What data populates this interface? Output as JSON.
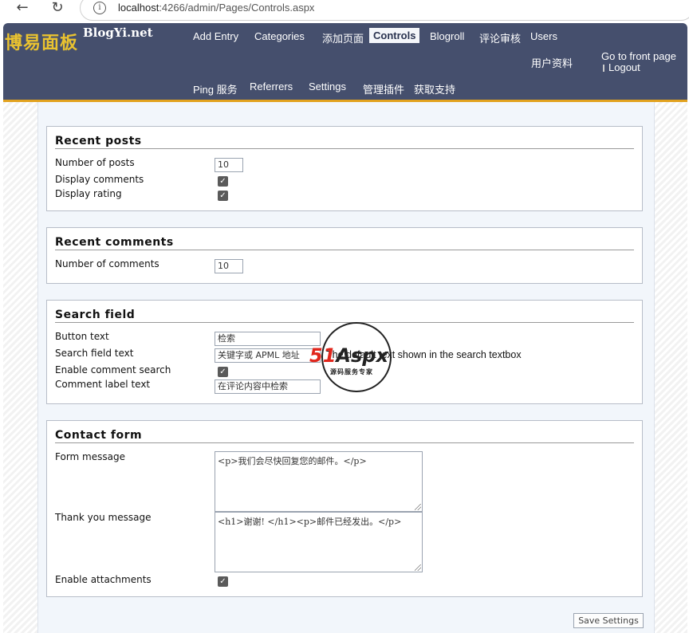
{
  "browser": {
    "back_icon": "←",
    "reload_icon": "↻",
    "info_icon": "i",
    "url_host": "localhost",
    "url_rest": ":4266/admin/Pages/Controls.aspx"
  },
  "header": {
    "logo": "博易面板",
    "logo_sub": "BlogYi.net",
    "menu_row1": [
      "Add Entry",
      "Categories",
      "添加页面",
      "Controls",
      "Blogroll",
      "评论审核",
      "Users"
    ],
    "menu_row2": [
      "Ping 服务",
      "Referrers",
      "Settings",
      "管理插件",
      "获取支持"
    ],
    "profile": "用户资料",
    "front_page": "Go to front page",
    "logout": "Logout",
    "active_item": "Controls",
    "colors": {
      "bar": "#454f6d",
      "accent": "#e2a21f",
      "logo": "#e9c230"
    }
  },
  "recent_posts": {
    "title": "Recent posts",
    "number_label": "Number of posts",
    "number_value": "10",
    "comments_label": "Display comments",
    "comments_checked": true,
    "rating_label": "Display rating",
    "rating_checked": true
  },
  "recent_comments": {
    "title": "Recent comments",
    "number_label": "Number of comments",
    "number_value": "10"
  },
  "search_field": {
    "title": "Search field",
    "button_label": "Button text",
    "button_value": "检索",
    "field_label": "Search field text",
    "field_value": "关键字或 APML 地址",
    "field_hint": "The default text shown in the search textbox",
    "enable_label": "Enable comment search",
    "enable_checked": true,
    "comment_label": "Comment label text",
    "comment_value": "在评论内容中检索"
  },
  "contact_form": {
    "title": "Contact form",
    "form_label": "Form message",
    "form_value": "<p>我们会尽快回复您的邮件。</p>",
    "thanks_label": "Thank you message",
    "thanks_value": "<h1>谢谢! </h1><p>邮件已经发出。</p>",
    "attach_label": "Enable attachments",
    "attach_checked": true
  },
  "save_button": "Save Settings",
  "watermark": {
    "brand_red": "51",
    "brand_dark": "Aspx",
    "subtitle": "源码服务专家"
  }
}
